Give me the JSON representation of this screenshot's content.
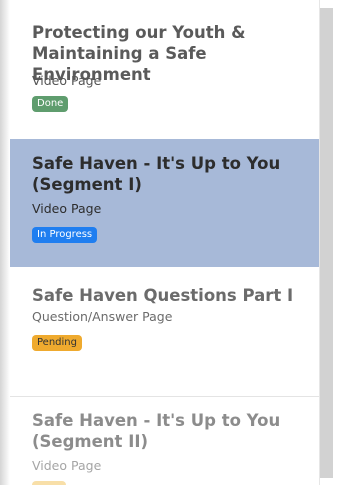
{
  "lessons": [
    {
      "title": "Protecting our Youth & Maintaining a Safe Environment",
      "type": "Video Page",
      "status": "Done"
    },
    {
      "title": "Safe Haven - It's Up to You (Segment I)",
      "type": "Video Page",
      "status": "In Progress"
    },
    {
      "title": "Safe Haven Questions Part I",
      "type": "Question/Answer Page",
      "status": "Pending"
    },
    {
      "title": "Safe Haven - It's Up to You (Segment II)",
      "type": "Video Page"
    }
  ],
  "colors": {
    "done": "#5f9d6e",
    "in_progress": "#1f7ef0",
    "pending": "#efaa2e",
    "active_background": "#a7b9d8"
  }
}
